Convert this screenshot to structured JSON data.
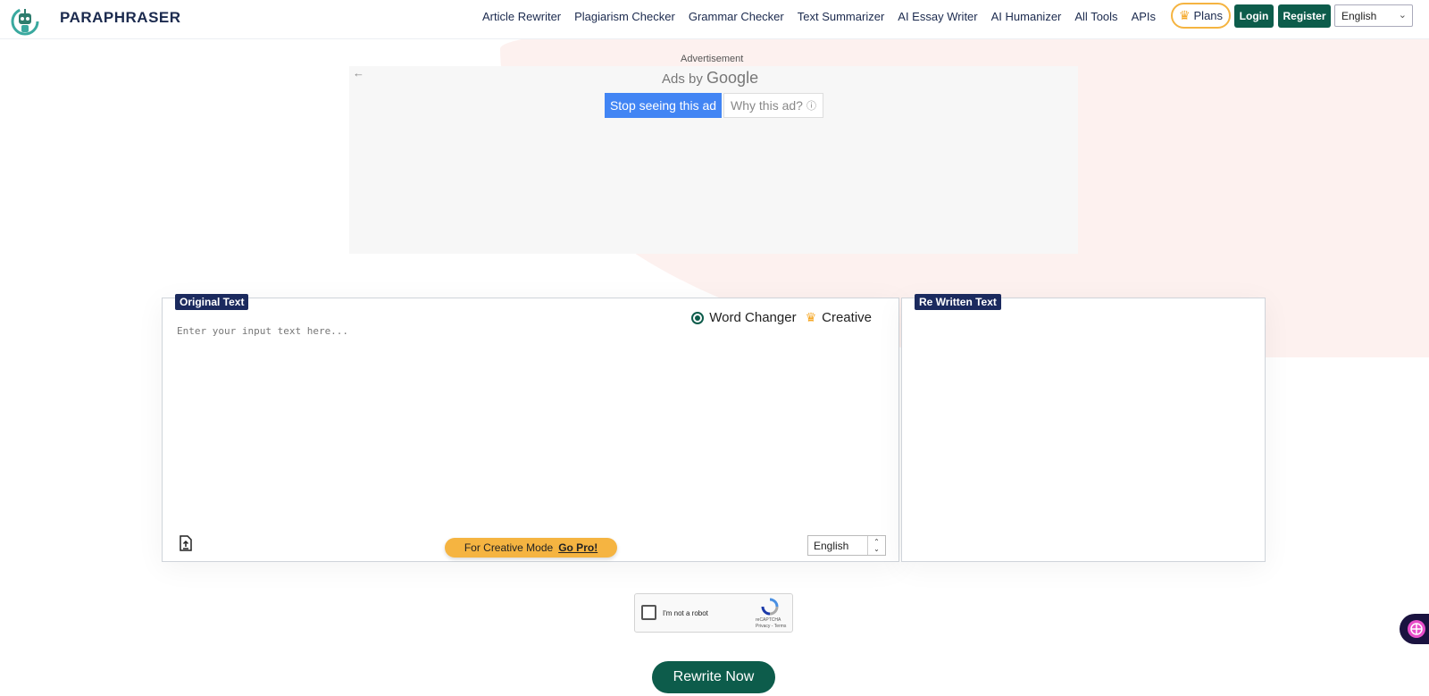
{
  "header": {
    "brand": "PARAPHRASER",
    "nav": [
      "Article Rewriter",
      "Plagiarism Checker",
      "Grammar Checker",
      "Text Summarizer",
      "AI Essay Writer",
      "AI Humanizer",
      "All Tools",
      "APIs"
    ],
    "plans_label": "Plans",
    "login_label": "Login",
    "register_label": "Register",
    "language": "English"
  },
  "ad": {
    "label": "Advertisement",
    "ads_by": "Ads by",
    "google": "Google",
    "stop_label": "Stop seeing this ad",
    "why_label": "Why this ad?"
  },
  "left_panel": {
    "label": "Original Text",
    "mode_word_changer": "Word Changer",
    "mode_creative": "Creative",
    "placeholder": "Enter your input text here...",
    "gopro_text": "For Creative Mode",
    "gopro_link": "Go Pro!",
    "language": "English"
  },
  "right_panel": {
    "label": "Re Written Text"
  },
  "captcha": {
    "text": "I'm not a robot",
    "brand": "reCAPTCHA",
    "links": "Privacy - Terms"
  },
  "rewrite_label": "Rewrite Now",
  "colors": {
    "primary": "#0d5c4b",
    "navy": "#1b2a5e",
    "accent": "#f5b441",
    "google_blue": "#4285f4"
  }
}
